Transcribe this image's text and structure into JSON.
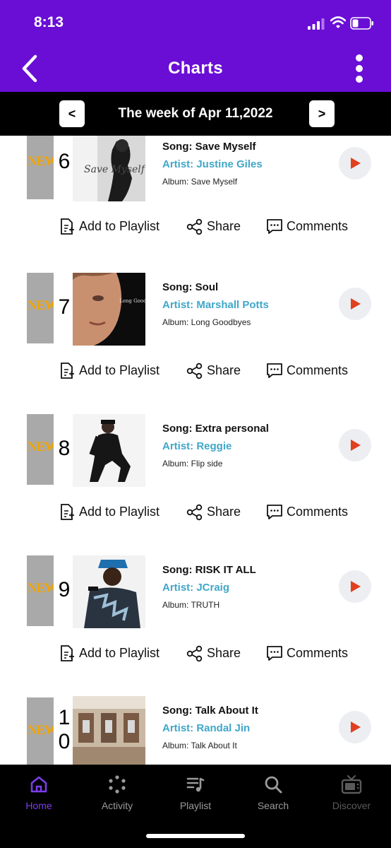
{
  "status_bar": {
    "time": "8:13"
  },
  "header": {
    "title": "Charts"
  },
  "week": {
    "prev_label": "<",
    "label": "The week of Apr 11,2022",
    "next_label": ">"
  },
  "actions": {
    "add_to_playlist": "Add to Playlist",
    "share": "Share",
    "comments": "Comments"
  },
  "badge": "NEW",
  "entries": [
    {
      "rank": "6",
      "song": "Song: Save Myself",
      "artist": "Artist: Justine Giles",
      "album": "Album: Save Myself",
      "cover_text": "Save Myself"
    },
    {
      "rank": "7",
      "song": "Song: Soul",
      "artist": "Artist: Marshall Potts",
      "album": "Album: Long Goodbyes",
      "cover_text": "Long Goodbyes"
    },
    {
      "rank": "8",
      "song": "Song: Extra personal",
      "artist": "Artist: Reggie",
      "album": "Album: Flip side"
    },
    {
      "rank": "9",
      "song": "Song: RISK IT ALL",
      "artist": "Artist: JCraig",
      "album": "Album: TRUTH"
    },
    {
      "rank_line1": "1",
      "rank_line2": "0",
      "song": "Song: Talk About It",
      "artist": "Artist: Randal Jin",
      "album": "Album: Talk About It"
    }
  ],
  "tabs": [
    {
      "label": "Home",
      "icon": "home-icon",
      "active": true
    },
    {
      "label": "Activity",
      "icon": "activity-icon"
    },
    {
      "label": "Playlist",
      "icon": "playlist-icon"
    },
    {
      "label": "Search",
      "icon": "search-icon"
    },
    {
      "label": "Discover",
      "icon": "tv-icon"
    }
  ],
  "colors": {
    "header": "#6a0ed6",
    "artist": "#3fa7c9",
    "play": "#e0401f",
    "active_tab": "#7b3dea",
    "badge_text": "#f2a400"
  }
}
